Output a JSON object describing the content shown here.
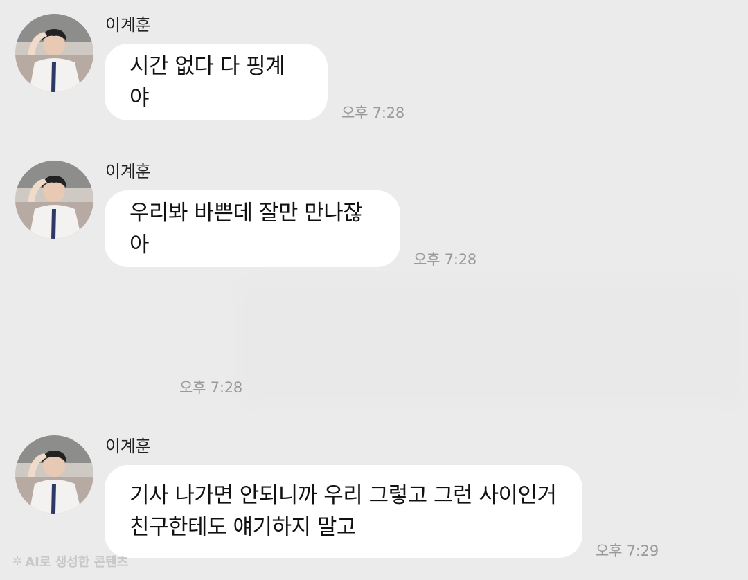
{
  "messages": [
    {
      "sender": "이계훈",
      "lines": [
        "시간 없다 다 핑계야"
      ],
      "time": "오후 7:28"
    },
    {
      "sender": "이계훈",
      "lines": [
        "우리봐 바쁜데 잘만 만나잖아"
      ],
      "time": "오후 7:28"
    },
    {
      "sender": "",
      "lines": [],
      "time": "오후 7:28"
    },
    {
      "sender": "이계훈",
      "lines": [
        "기사 나가면 안되니까 우리 그렇고 그런 사이인거",
        "친구한테도 얘기하지 말고"
      ],
      "time": "오후 7:29"
    }
  ],
  "watermark": {
    "icon": "sparkle-icon",
    "text": "AI로 생성한 콘텐츠"
  },
  "colors": {
    "background": "#ebebeb",
    "bubble": "#ffffff",
    "time": "#9a9a9a"
  }
}
